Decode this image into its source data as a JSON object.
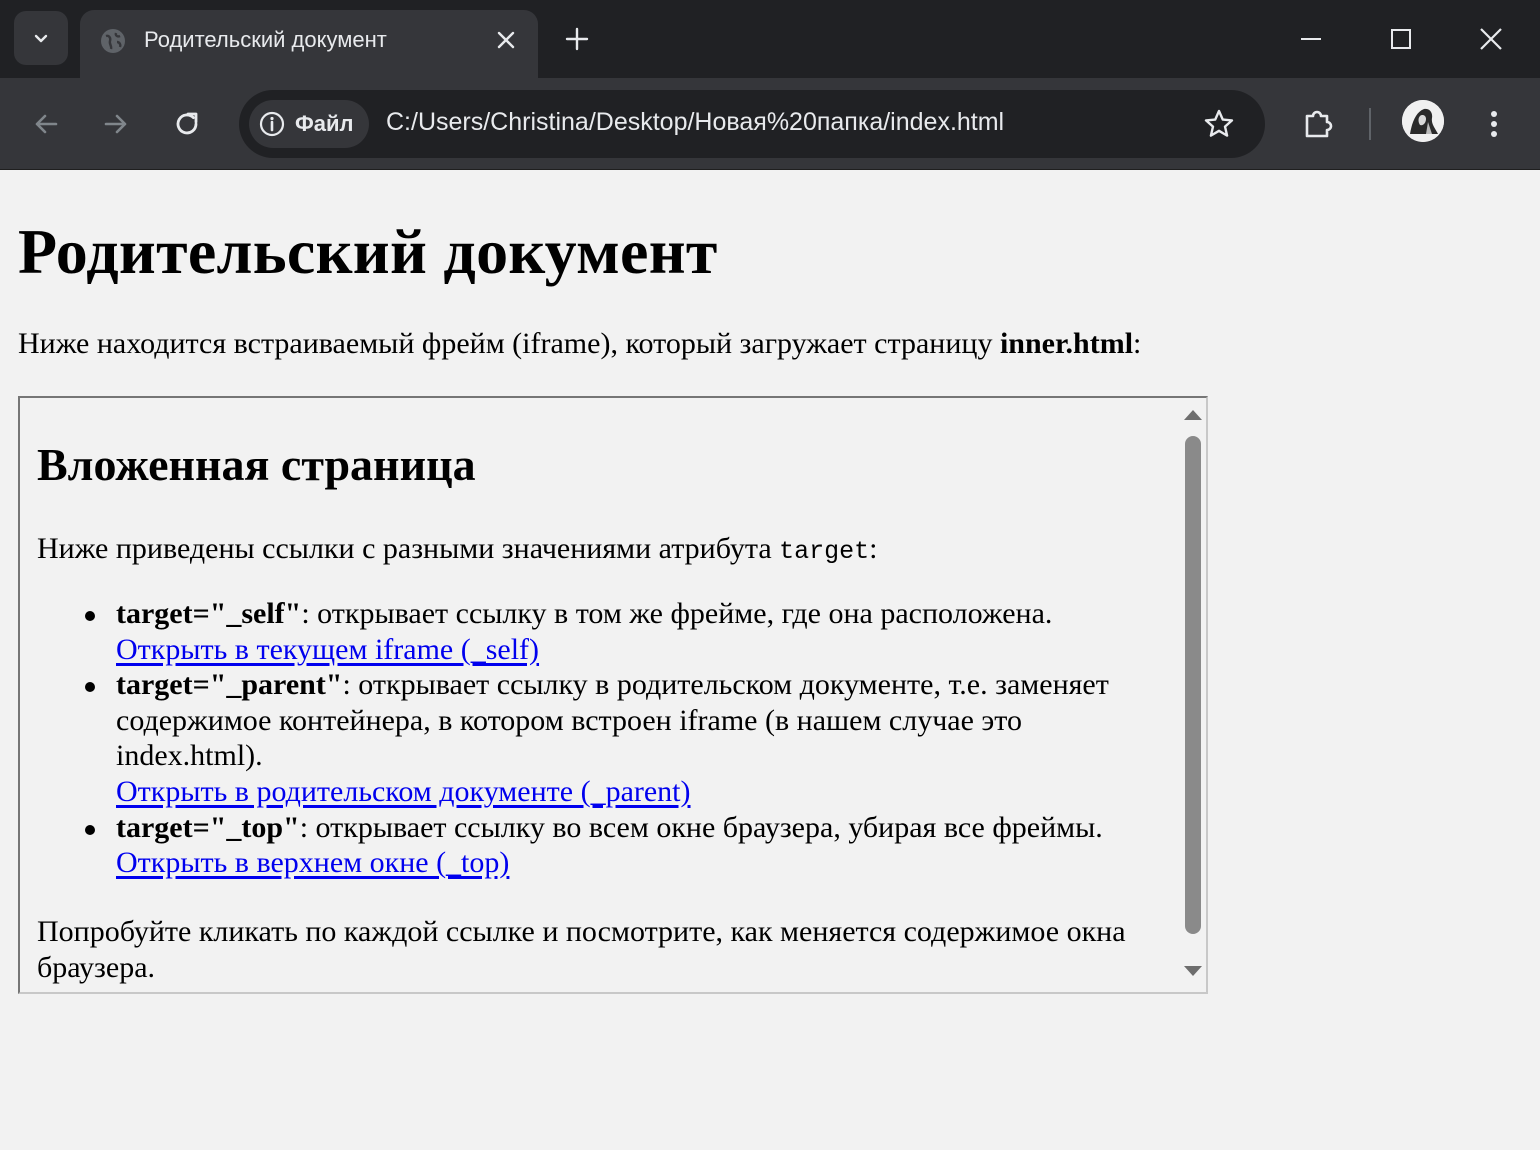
{
  "browser": {
    "tab": {
      "title": "Родительский документ"
    },
    "omnibox": {
      "site_chip_label": "Файл",
      "url": "C:/Users/Christina/Desktop/Новая%20папка/index.html"
    }
  },
  "page": {
    "heading": "Родительский документ",
    "intro_text": "Ниже находится встраиваемый фрейм (iframe), который загружает страницу ",
    "intro_bold": "inner.html",
    "intro_end": ":",
    "iframe": {
      "heading": "Вложенная страница",
      "desc_text": "Ниже приведены ссылки с разными значениями атрибута ",
      "desc_code": "target",
      "desc_end": ":",
      "items": [
        {
          "bold": "target=\"_self\"",
          "text": ": открывает ссылку в том же фрейме, где она расположена.",
          "link": "Открыть в текущем iframe (_self)"
        },
        {
          "bold": "target=\"_parent\"",
          "text": ": открывает ссылку в родительском документе, т.е. заменяет содержимое контейнера, в котором встроен iframe (в нашем случае это index.html).",
          "link": "Открыть в родительском документе (_parent)"
        },
        {
          "bold": "target=\"_top\"",
          "text": ": открывает ссылку во всем окне браузера, убирая все фреймы.",
          "link": "Открыть в верхнем окне (_top)"
        }
      ],
      "footer": "Попробуйте кликать по каждой ссылке и посмотрите, как меняется содержимое окна браузера."
    }
  },
  "colors": {
    "chrome_dark": "#202124",
    "chrome_mid": "#35363a",
    "link": "#0000ee",
    "page_bg": "#f2f2f2"
  }
}
